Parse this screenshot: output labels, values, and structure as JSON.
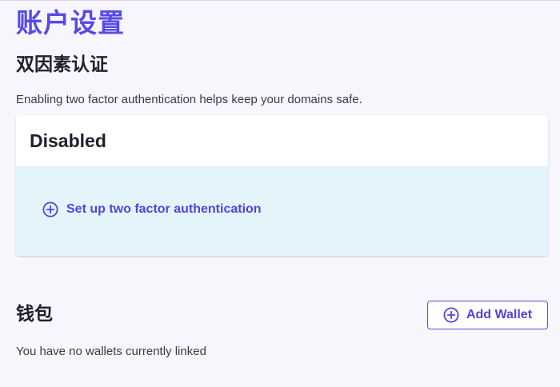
{
  "page": {
    "title": "账户设置"
  },
  "two_factor": {
    "title": "双因素认证",
    "description": "Enabling two factor authentication helps keep your domains safe.",
    "status": "Disabled",
    "setup_label": "Set up two factor authentication"
  },
  "wallet": {
    "title": "钱包",
    "add_label": "Add Wallet",
    "empty_text": "You have no wallets currently linked"
  },
  "colors": {
    "accent": "#5849e8",
    "card_body_bg": "#e4f4fb",
    "page_bg": "#f6f6fc"
  },
  "icons": {
    "setup": "plus-circle-icon",
    "add_wallet": "plus-circle-icon"
  }
}
